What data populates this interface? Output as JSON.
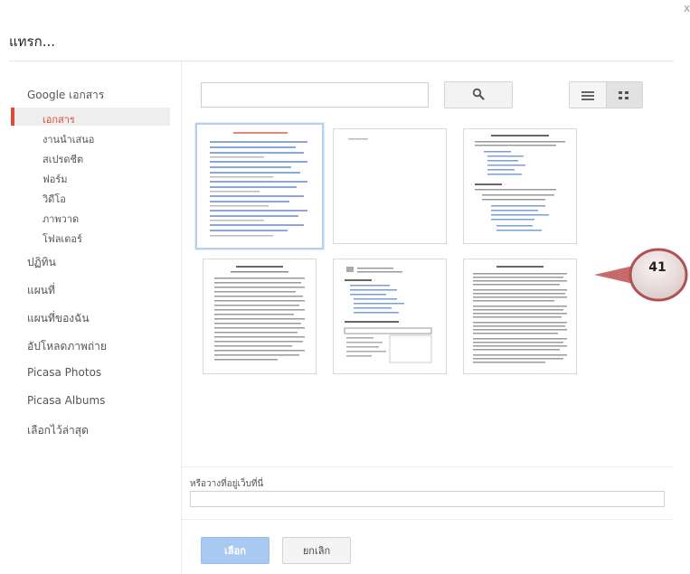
{
  "dialog": {
    "title": "แทรก...",
    "close_glyph": "x"
  },
  "sidebar": {
    "items": [
      {
        "label": "Google เอกสาร"
      },
      {
        "label": "เอกสาร",
        "active": true
      },
      {
        "label": "งานนำเสนอ"
      },
      {
        "label": "สเปรดชีต"
      },
      {
        "label": "ฟอร์ม"
      },
      {
        "label": "วิดีโอ"
      },
      {
        "label": "ภาพวาด"
      },
      {
        "label": "โฟลเดอร์"
      },
      {
        "label": "ปฏิทิน"
      },
      {
        "label": "แผนที่"
      },
      {
        "label": "แผนที่ของฉัน"
      },
      {
        "label": "อัปโหลดภาพถ่าย"
      },
      {
        "label": "Picasa Photos"
      },
      {
        "label": "Picasa Albums"
      },
      {
        "label": "เลือกไว้ล่าสุด"
      }
    ]
  },
  "search": {
    "value": "",
    "icon": "search-icon"
  },
  "view_toggle": {
    "list_icon": "list-view-icon",
    "grid_icon": "grid-view-icon",
    "selected": "grid"
  },
  "documents": {
    "count": 6,
    "selected_index": 0
  },
  "callout": {
    "number": "41"
  },
  "url_section": {
    "label": "หรือวางที่อยู่เว็บที่นี่",
    "value": ""
  },
  "buttons": {
    "select_label": "เลือก",
    "cancel_label": "ยกเลิก"
  },
  "colors": {
    "accent": "#dd4b39",
    "primary_button": "#a9c9f2",
    "selected_border": "#b8d0ec"
  }
}
